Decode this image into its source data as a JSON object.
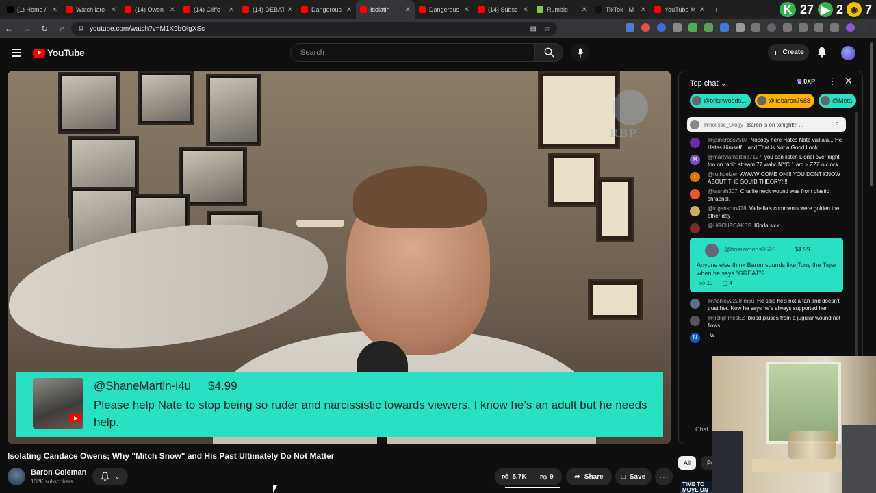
{
  "browser": {
    "tabs": [
      {
        "label": "(1) Home /",
        "color": "#000000"
      },
      {
        "label": "Watch late",
        "color": "#ff0000"
      },
      {
        "label": "(14) Owen",
        "color": "#ff0000"
      },
      {
        "label": "(14) Cliffe",
        "color": "#ff0000"
      },
      {
        "label": "(14) DEBAT",
        "color": "#ff0000"
      },
      {
        "label": "Dangerous",
        "color": "#ff0000"
      },
      {
        "label": "Isolatin",
        "color": "#ff0000"
      },
      {
        "label": "Dangerous",
        "color": "#ff0000"
      },
      {
        "label": "(14) Subsc",
        "color": "#ff0000"
      },
      {
        "label": "Rumble",
        "color": "#85c742"
      },
      {
        "label": "TikTok - M",
        "color": "#111111"
      },
      {
        "label": "YouTube M",
        "color": "#ff0000"
      }
    ],
    "active_tab_index": 6,
    "extension_badges": {
      "k": "K",
      "num1": "27",
      "num2": "2",
      "num3": "7"
    },
    "url": "youtube.com/watch?v=M1X9bOlgXSc"
  },
  "youtube": {
    "logo_text": "YouTube",
    "search_placeholder": "Search",
    "create_label": "Create"
  },
  "video": {
    "superchat": {
      "user": "@ShaneMartin-i4u",
      "amount": "$4.99",
      "message": "Please help Nate to stop being so ruder and narcissistic towards viewers. I know he’s an adult but he needs help."
    },
    "watermark_text": "RBP"
  },
  "details": {
    "title": "Isolating Candace Owens; Why \"Mitch Snow\" and His Past Ultimately Do Not Matter",
    "channel_name": "Baron Coleman",
    "subscribers": "132K subscribers",
    "likes": "5.7K",
    "dislikes": "9",
    "share_label": "Share",
    "save_label": "Save"
  },
  "chat": {
    "header": "Top chat",
    "xp_label": "0XP",
    "pills": [
      {
        "label": "@brianwoods...",
        "color": "#2ae0c3"
      },
      {
        "label": "@llebaron7688",
        "color": "#ffb300"
      },
      {
        "label": "@Meta",
        "color": "#2ae0c3"
      }
    ],
    "pinned": {
      "user": "@holistic_Ology",
      "text": "Baron is on tonight!!! ..."
    },
    "messages": [
      {
        "user": "@jameross7507",
        "text": "Nobody here Hates Nate vaillala... He Hates Himself....and That is Not a Good Look",
        "avatar_color": "#6a2ab0",
        "initial": ""
      },
      {
        "user": "@martylamartina7127",
        "text": "you can listen Lionel over night too on radio stream 77 wabc NYC 1 am > ZZZ o clock",
        "avatar_color": "#7b52c9",
        "initial": "M"
      },
      {
        "user": "@ruthpelzer",
        "text": "AWWW COME ON!!! YOU DONT KNOW ABOUT THE SQUIB THEORY!!!!",
        "avatar_color": "#e8710a",
        "initial": "r"
      },
      {
        "user": "@laurah307",
        "text": "Charlie neck wound was from plastic shrapnel.",
        "avatar_color": "#e4582e",
        "initial": "l"
      },
      {
        "user": "@logansrun478",
        "text": "Valhalla's comments were golden the other day",
        "avatar_color": "#c7b25a",
        "initial": ""
      },
      {
        "user": "@HGCUPCAKES",
        "text": "Kinda sick...",
        "avatar_color": "#7a2c2c",
        "initial": ""
      }
    ],
    "superchat_card": {
      "user": "@brianwoods9526",
      "amount": "$4.99",
      "text": "Anyone else think Baron sounds like Tony the Tiger when he says \"GREAT\"?",
      "likes": "19",
      "replies": "4"
    },
    "messages_after": [
      {
        "user": "@Ashley2228-m6u",
        "text": "He said he's not a fan and doesn't trust her. Now he says he's always supported her",
        "avatar_color": "#5f6f8a",
        "initial": ""
      },
      {
        "user": "@rickgrimesEZ",
        "text": "blood pluses from a jugular wound not flows",
        "avatar_color": "#555555",
        "initial": ""
      },
      {
        "user": "",
        "text": "w",
        "avatar_color": "#1a57b7",
        "initial": "N"
      }
    ],
    "input_placeholder": "Chat"
  },
  "chips": [
    "All",
    "Po"
  ],
  "ad_text": "TIME TO MOVE ON"
}
